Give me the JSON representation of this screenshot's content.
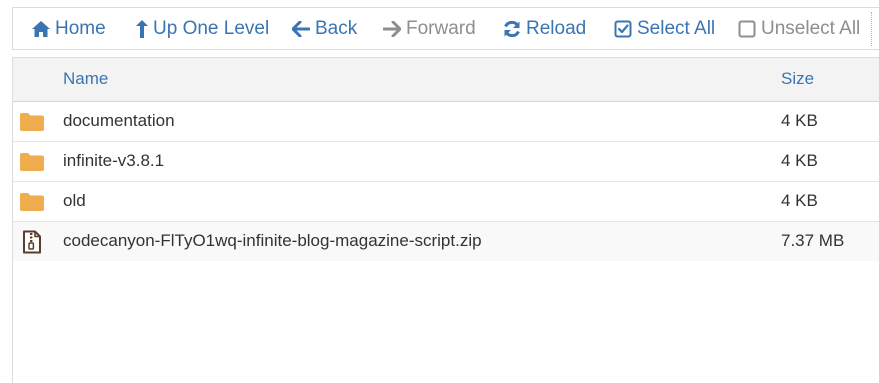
{
  "toolbar": {
    "home_label": "Home",
    "up_label": "Up One Level",
    "back_label": "Back",
    "forward_label": "Forward",
    "reload_label": "Reload",
    "select_all_label": "Select All",
    "unselect_all_label": "Unselect All"
  },
  "table": {
    "headers": {
      "name": "Name",
      "size": "Size"
    },
    "rows": [
      {
        "type": "folder",
        "icon": "folder-icon",
        "name": "documentation",
        "size": "4 KB"
      },
      {
        "type": "folder",
        "icon": "folder-icon",
        "name": "infinite-v3.8.1",
        "size": "4 KB"
      },
      {
        "type": "folder",
        "icon": "folder-icon",
        "name": "old",
        "size": "4 KB"
      },
      {
        "type": "zip",
        "icon": "zip-file-icon",
        "name": "codecanyon-FlTyO1wq-infinite-blog-magazine-script.zip",
        "size": "7.37 MB"
      }
    ]
  },
  "colors": {
    "link_blue": "#3a75b3",
    "disabled_gray": "#8e8e8e",
    "folder_orange": "#f0ad4e",
    "header_bg": "#f3f3f3",
    "text_dark": "#333333"
  }
}
